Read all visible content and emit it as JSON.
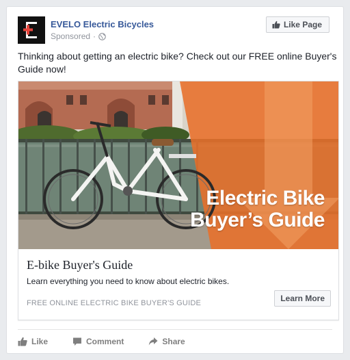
{
  "post": {
    "page_name": "EVELO Electric Bicycles",
    "sponsored": "Sponsored",
    "like_page_label": "Like Page",
    "text": "Thinking about getting an electric bike? Check out our FREE online Buyer's Guide now!"
  },
  "attachment": {
    "image_headline_line1": "Electric Bike",
    "image_headline_line2": "Buyer’s Guide",
    "title": "E-bike Buyer's Guide",
    "description": "Learn everything you need to know about electric bikes.",
    "caption": "FREE ONLINE ELECTRIC BIKE BUYER'S GUIDE",
    "cta_label": "Learn More"
  },
  "actions": [
    {
      "label": "Like",
      "icon": "thumbs-up-icon"
    },
    {
      "label": "Comment",
      "icon": "comment-icon"
    },
    {
      "label": "Share",
      "icon": "share-icon"
    }
  ],
  "colors": {
    "link_blue": "#365899",
    "orange": "#e8702a",
    "logo_red": "#e8453c",
    "muted_gray": "#90949c"
  }
}
